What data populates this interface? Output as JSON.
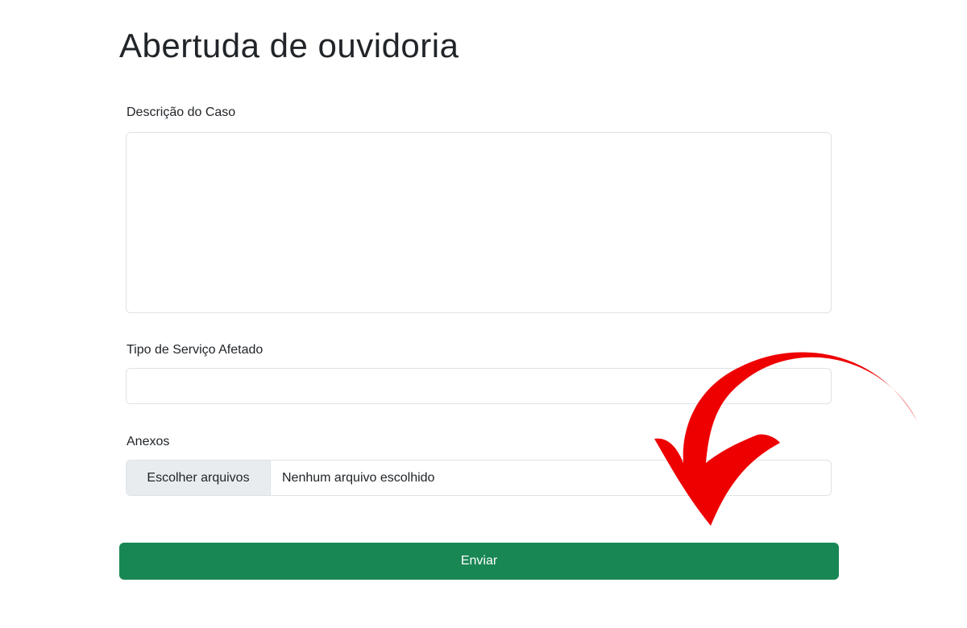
{
  "page": {
    "title": "Abertuda de ouvidoria"
  },
  "form": {
    "description": {
      "label": "Descrição do Caso",
      "value": ""
    },
    "service_type": {
      "label": "Tipo de Serviço Afetado",
      "value": ""
    },
    "attachments": {
      "label": "Anexos",
      "button_label": "Escolher arquivos",
      "status": "Nenhum arquivo escolhido"
    },
    "submit_label": "Enviar"
  },
  "colors": {
    "submit_button": "#198754",
    "annotation_arrow": "#ee0000",
    "input_border": "#dee2e6"
  },
  "icons": {
    "annotation": "red-curved-arrow-icon"
  }
}
